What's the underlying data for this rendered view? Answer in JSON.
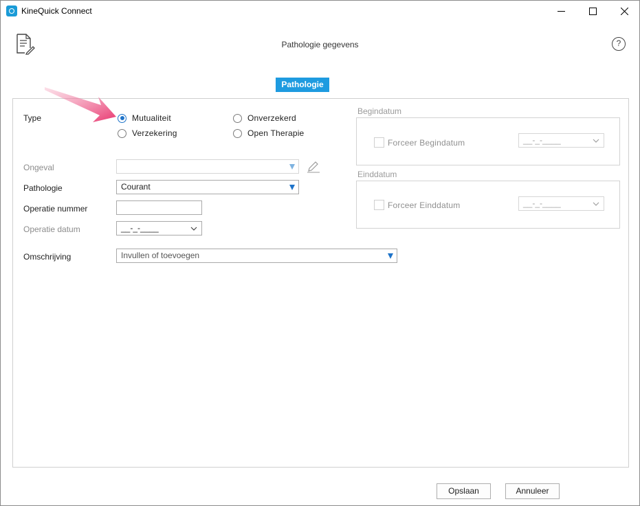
{
  "window": {
    "title": "KineQuick Connect",
    "controls": {
      "minimize": "minimize-icon",
      "maximize": "maximize-icon",
      "close": "close-icon"
    }
  },
  "header": {
    "title": "Pathologie gegevens",
    "help": "?"
  },
  "tabs": [
    {
      "label": "Pathologie",
      "active": true
    }
  ],
  "form": {
    "type": {
      "label": "Type",
      "options": [
        {
          "label": "Mutualiteit",
          "checked": true
        },
        {
          "label": "Onverzekerd",
          "checked": false
        },
        {
          "label": "Verzekering",
          "checked": false
        },
        {
          "label": "Open Therapie",
          "checked": false
        }
      ]
    },
    "ongeval": {
      "label": "Ongeval",
      "value": "",
      "disabled": true
    },
    "pathologie": {
      "label": "Pathologie",
      "value": "Courant"
    },
    "operatie_nummer": {
      "label": "Operatie nummer",
      "value": ""
    },
    "operatie_datum": {
      "label": "Operatie datum",
      "value": "__-_-____"
    },
    "omschrijving": {
      "label": "Omschrijving",
      "value": "Invullen of toevoegen"
    }
  },
  "begindatum": {
    "title": "Begindatum",
    "checkbox_label": "Forceer Begindatum",
    "date_value": "__-_-____"
  },
  "einddatum": {
    "title": "Einddatum",
    "checkbox_label": "Forceer Einddatum",
    "date_value": "__-_-____"
  },
  "footer": {
    "save_label": "Opslaan",
    "cancel_label": "Annuleer"
  },
  "colors": {
    "accent": "#1e9be0",
    "annotation_arrow": "#e8356e",
    "radio_selected": "#1e73c9"
  }
}
